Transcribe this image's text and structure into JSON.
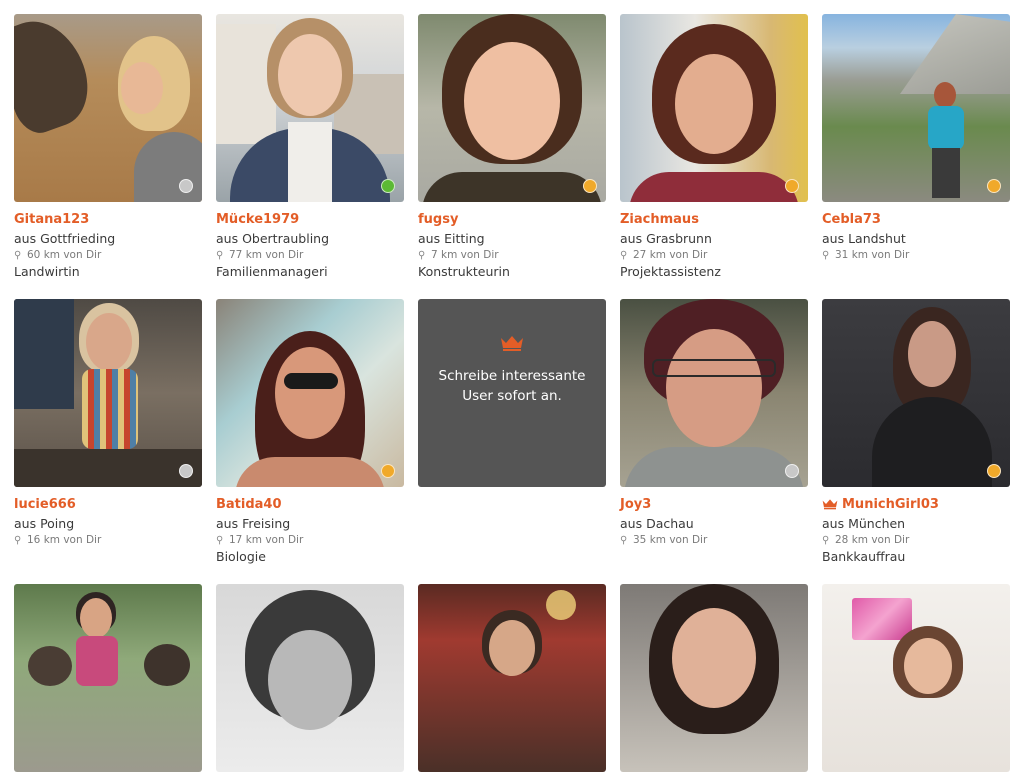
{
  "colors": {
    "accent": "#e35d27",
    "status_offline": "#c8c8c8",
    "status_online": "#5cb934",
    "status_away": "#f0a92a",
    "promo_background": "#555555"
  },
  "profiles": [
    {
      "name": "Gitana123",
      "city": "aus Gottfrieding",
      "distance": "60 km von Dir",
      "job": "Landwirtin",
      "status": "offline"
    },
    {
      "name": "Mücke1979",
      "city": "aus Obertraubling",
      "distance": "77 km von Dir",
      "job": "Familienmanageri",
      "status": "online"
    },
    {
      "name": "fugsy",
      "city": "aus Eitting",
      "distance": "7 km von Dir",
      "job": "Konstrukteurin",
      "status": "away"
    },
    {
      "name": "Ziachmaus",
      "city": "aus Grasbrunn",
      "distance": "27 km von Dir",
      "job": "Projektassistenz",
      "status": "away"
    },
    {
      "name": "Cebla73",
      "city": "aus Landshut",
      "distance": "31 km von Dir",
      "job": "",
      "status": "away"
    },
    {
      "name": "lucie666",
      "city": "aus Poing",
      "distance": "16 km von Dir",
      "job": "",
      "status": "offline"
    },
    {
      "name": "Batida40",
      "city": "aus Freising",
      "distance": "17 km von Dir",
      "job": "Biologie",
      "status": "away"
    },
    {
      "name": "Joy3",
      "city": "aus Dachau",
      "distance": "35 km von Dir",
      "job": "",
      "status": "offline"
    },
    {
      "name": "MunichGirl03",
      "city": "aus München",
      "distance": "28 km von Dir",
      "job": "Bankkauffrau",
      "status": "away",
      "premium": true
    }
  ],
  "promo": {
    "text": "Schreibe interessante\nUser sofort an.",
    "icon": "crown-icon"
  },
  "icons": {
    "distance": "map-pin-icon",
    "premium": "crown-icon"
  }
}
